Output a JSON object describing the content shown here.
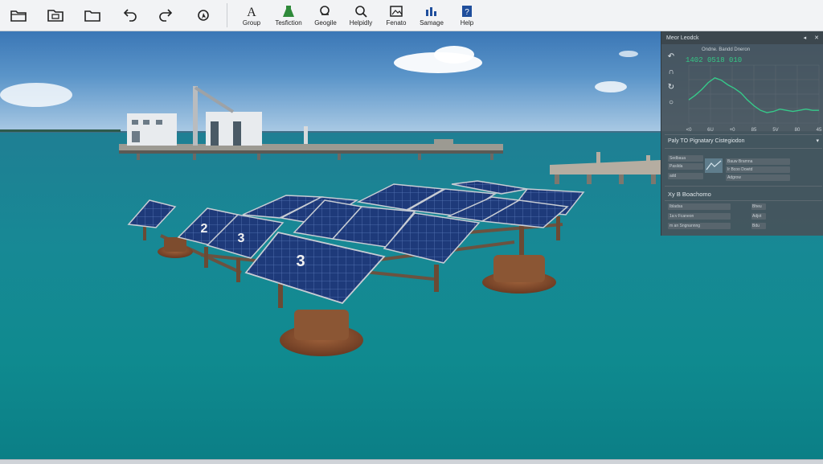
{
  "toolbar": {
    "labeled": [
      {
        "label": "Group",
        "icon": "letter-a-icon"
      },
      {
        "label": "Tesfiction",
        "icon": "flask-icon"
      },
      {
        "label": "Geogile",
        "icon": "search-icon"
      },
      {
        "label": "Helpidly",
        "icon": "zoom-icon"
      },
      {
        "label": "Fenato",
        "icon": "image-icon"
      },
      {
        "label": "Samage",
        "icon": "bar-chart-icon"
      },
      {
        "label": "Help",
        "icon": "help-book-icon"
      }
    ]
  },
  "scene": {
    "panel_numbers": [
      "2",
      "3",
      "3"
    ]
  },
  "panel": {
    "title": "Meor Leodck",
    "chart": {
      "caption": "Ondne. Bandd Dneron",
      "readout": "1402 0518 010",
      "line_color": "#36c98a"
    },
    "chart_data": {
      "type": "line",
      "x": [
        0,
        1,
        2,
        3,
        4,
        5,
        6,
        7,
        8,
        9,
        10,
        11,
        12,
        13,
        14,
        15,
        16,
        17,
        18,
        19,
        20
      ],
      "values": [
        40,
        48,
        58,
        70,
        78,
        74,
        66,
        60,
        52,
        40,
        30,
        22,
        18,
        20,
        24,
        22,
        20,
        22,
        24,
        22,
        22
      ],
      "xticks": [
        "<0",
        "6U",
        "+0",
        "85",
        "5V",
        "80",
        "45"
      ],
      "ylim": [
        0,
        100
      ],
      "grid": true
    },
    "section1_title": "Paly TO Pignatary Cistegiodon",
    "section2_title": "Xy B Boachomo",
    "rows": [
      {
        "c1": "Sedbaua",
        "c2": "",
        "c3": "Bauw Bramna"
      },
      {
        "c1": "Pasilda",
        "c2": "",
        "c3": "Ir Bcoo Dowtd"
      },
      {
        "c1": "add",
        "c2": "",
        "c3": "Adgrow"
      },
      {
        "c1": "Ibladsa",
        "c2": "",
        "c3": "Bheu"
      },
      {
        "c1": "1a:v Fcaneon",
        "c2": "",
        "c3": "Adjot"
      },
      {
        "c1": "m an Sngnannng",
        "c2": "",
        "c3": "Bdu"
      }
    ]
  }
}
